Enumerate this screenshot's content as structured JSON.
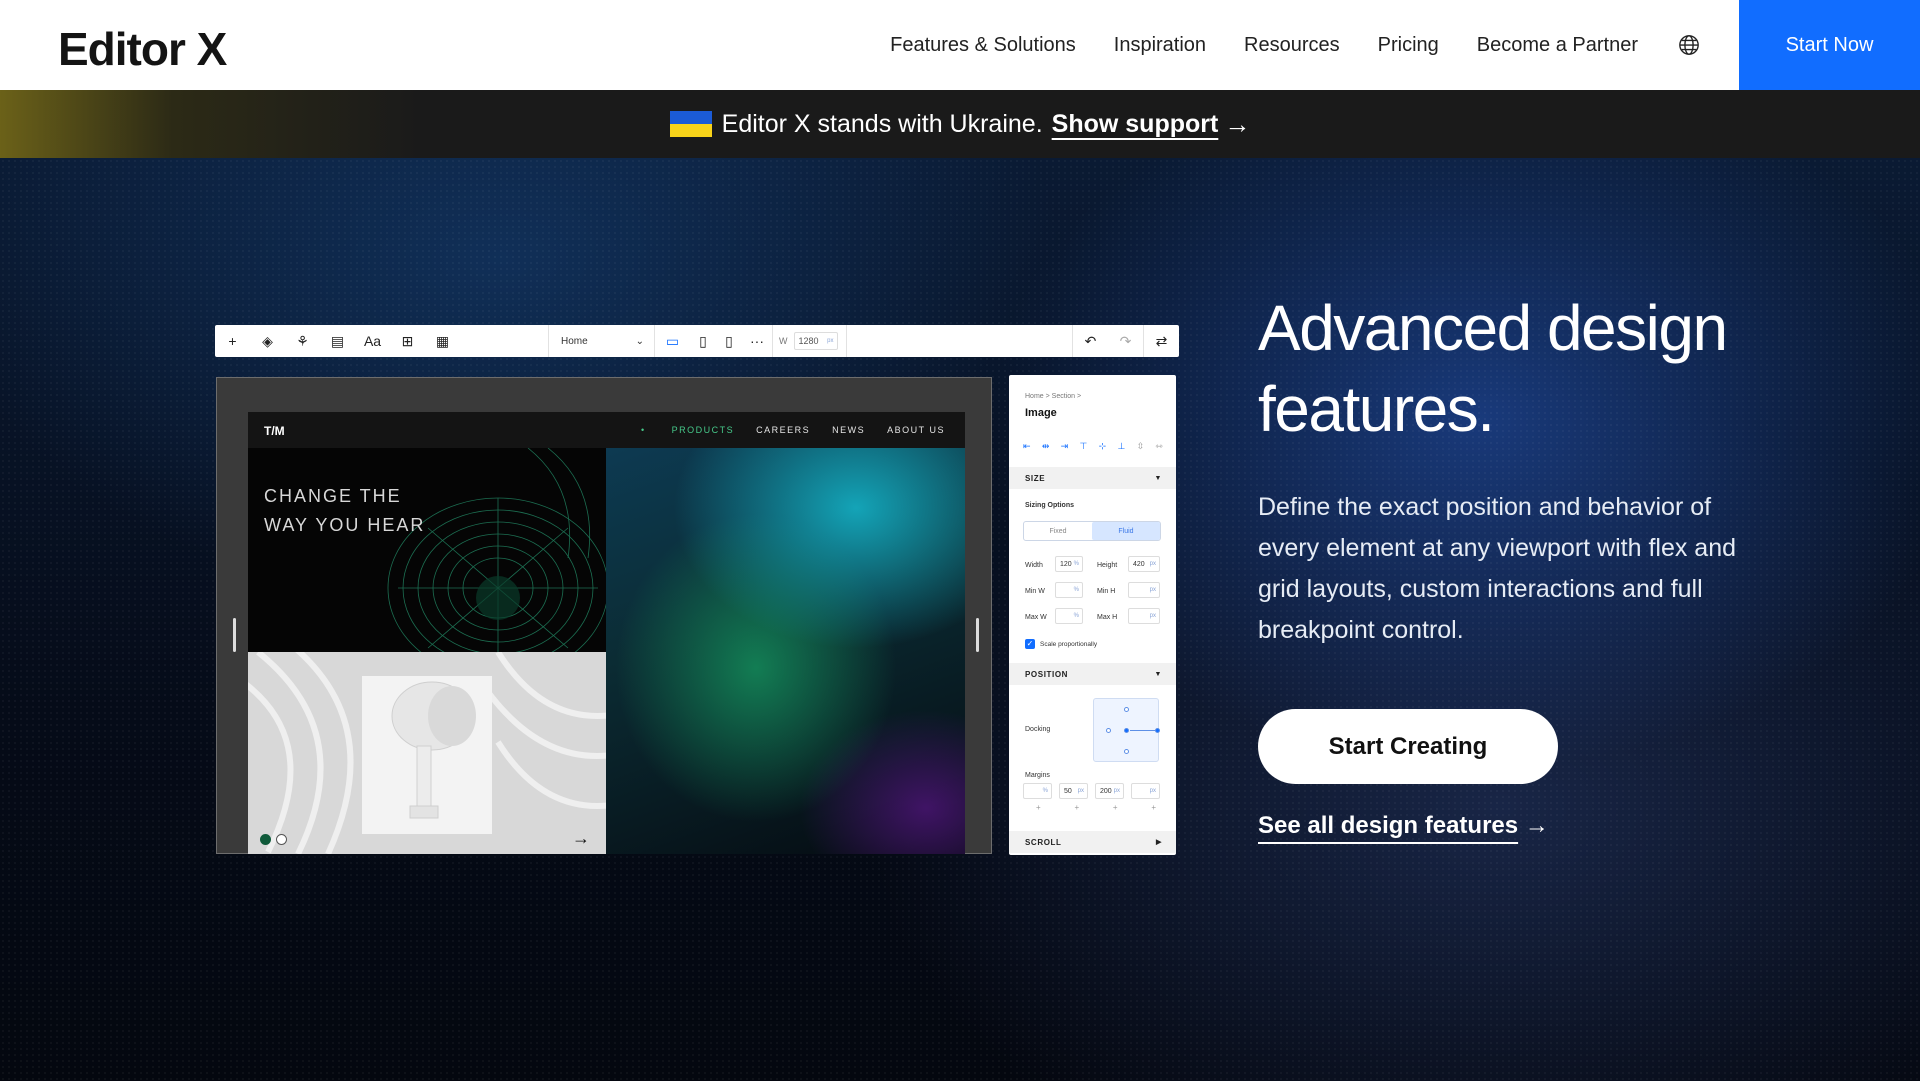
{
  "nav": {
    "logo": "Editor X",
    "links": [
      "Features & Solutions",
      "Inspiration",
      "Resources",
      "Pricing",
      "Become a Partner"
    ],
    "cta": "Start Now"
  },
  "banner": {
    "text": "Editor X stands with Ukraine.",
    "link": "Show support"
  },
  "hero": {
    "title_line1": "Advanced design",
    "title_line2": "features.",
    "description": "Define the exact position and behavior of every element at any viewport with flex and grid layouts, custom interactions and full breakpoint control.",
    "cta": "Start Creating",
    "link": "See all design features"
  },
  "editor": {
    "page_select": "Home",
    "width_label": "W",
    "width_value": "1280",
    "width_unit": "px",
    "site": {
      "logo": "T/M",
      "links": [
        "PRODUCTS",
        "CAREERS",
        "NEWS",
        "ABOUT US"
      ],
      "headline_line1": "CHANGE THE",
      "headline_line2": "WAY YOU HEAR"
    },
    "inspector": {
      "breadcrumb": "Home  >  Section  >",
      "title": "Image",
      "size_section": "SIZE",
      "sizing_options": "Sizing Options",
      "fixed": "Fixed",
      "fluid": "Fluid",
      "width_label": "Width",
      "width_value": "120",
      "width_unit": "%",
      "height_label": "Height",
      "height_value": "420",
      "height_unit": "px",
      "min_w": "Min W",
      "min_h": "Min H",
      "max_w": "Max W",
      "max_h": "Max H",
      "pct": "%",
      "px": "px",
      "scale": "Scale proportionally",
      "position_section": "POSITION",
      "docking": "Docking",
      "margins": "Margins",
      "margin_1": "%",
      "margin_2": "50",
      "margin_3": "200",
      "margin_4": "px",
      "scroll_section": "SCROLL"
    }
  },
  "colors": {
    "accent": "#116dff",
    "active_link": "#46c98a"
  }
}
